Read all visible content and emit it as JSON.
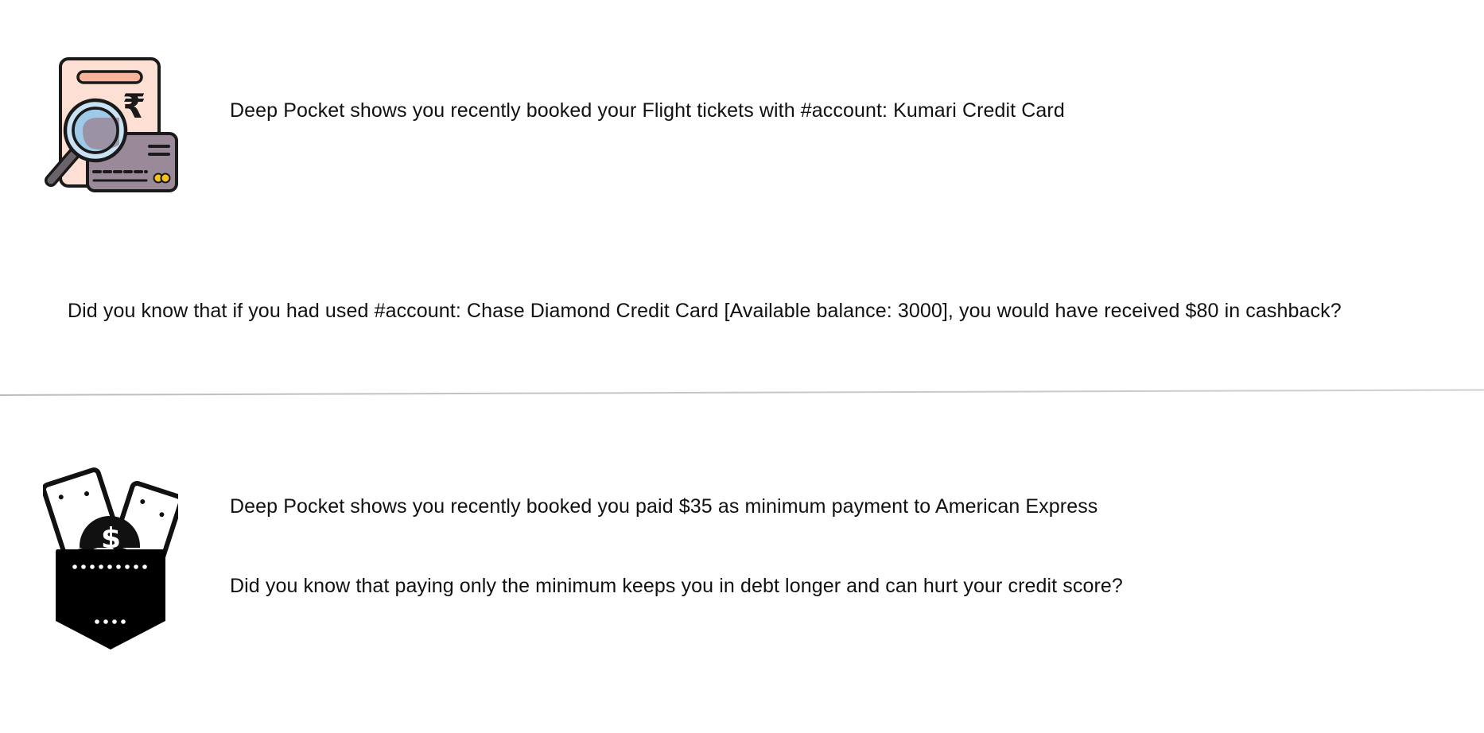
{
  "card1": {
    "icon": "receipt-magnifier-card-icon",
    "message": "Deep Pocket shows you recently booked your Flight tickets  with #account: Kumari Credit Card",
    "tip": "Did you know that if you had used #account: Chase Diamond Credit Card [Available balance: 3000], you would have received $80 in cashback?",
    "currency_symbol": "₹"
  },
  "card2": {
    "icon": "pocket-with-cards-and-dollar-icon",
    "message": "Deep Pocket shows you recently booked you paid $35 as minimum payment to American Express",
    "tip": "Did you know that paying only the minimum keeps you in debt longer and can hurt your credit score?",
    "currency_symbol": "$"
  },
  "colors": {
    "receipt_fill": "#fde0d3",
    "receipt_bar": "#f7b49a",
    "card_fill": "#9a8a99",
    "lens_fill": "#c9e3f5",
    "chip": "#f6c21c",
    "outline": "#1a1a1a"
  }
}
